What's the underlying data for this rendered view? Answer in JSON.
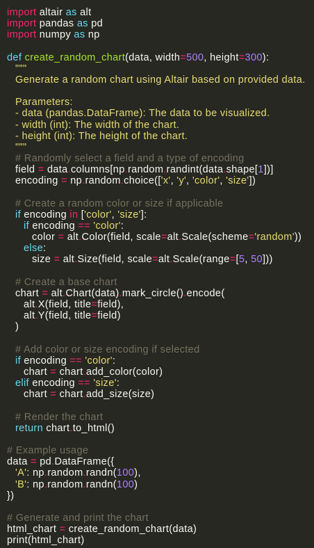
{
  "theme": {
    "background": "#272822",
    "colors": {
      "d": "#f8f8f2",
      "k": "#f92672",
      "o": "#f92672",
      "b": "#66d9ef",
      "f": "#a6e22e",
      "n": "#ae81ff",
      "s": "#e6db74",
      "c": "#75715e"
    }
  },
  "editor": {
    "language": "python",
    "lines": [
      {
        "i": 0,
        "t": [
          [
            "k",
            "import"
          ],
          [
            "d",
            " altair "
          ],
          [
            "b",
            "as"
          ],
          [
            "d",
            " alt"
          ]
        ]
      },
      {
        "i": 0,
        "t": [
          [
            "k",
            "import"
          ],
          [
            "d",
            " pandas "
          ],
          [
            "b",
            "as"
          ],
          [
            "d",
            " pd"
          ]
        ]
      },
      {
        "i": 0,
        "t": [
          [
            "k",
            "import"
          ],
          [
            "d",
            " numpy "
          ],
          [
            "b",
            "as"
          ],
          [
            "d",
            " np"
          ]
        ]
      },
      {
        "i": 0,
        "t": []
      },
      {
        "i": 0,
        "t": [
          [
            "b",
            "def"
          ],
          [
            "d",
            " "
          ],
          [
            "f",
            "create_random_chart"
          ],
          [
            "d",
            "(data, width"
          ],
          [
            "o",
            "="
          ],
          [
            "n",
            "500"
          ],
          [
            "d",
            ", height"
          ],
          [
            "o",
            "="
          ],
          [
            "n",
            "300"
          ],
          [
            "d",
            "):"
          ]
        ]
      },
      {
        "i": 1,
        "t": [
          [
            "s",
            "\"\"\""
          ]
        ]
      },
      {
        "i": 1,
        "t": [
          [
            "s",
            "Generate a random chart using Altair based on provided data."
          ]
        ]
      },
      {
        "i": 0,
        "t": []
      },
      {
        "i": 1,
        "t": [
          [
            "s",
            "Parameters:"
          ]
        ]
      },
      {
        "i": 1,
        "t": [
          [
            "s",
            "- data (pandas.DataFrame): The data to be visualized."
          ]
        ]
      },
      {
        "i": 1,
        "t": [
          [
            "s",
            "- width (int): The width of the chart."
          ]
        ]
      },
      {
        "i": 1,
        "t": [
          [
            "s",
            "- height (int): The height of the chart."
          ]
        ]
      },
      {
        "i": 1,
        "t": [
          [
            "s",
            "\"\"\""
          ]
        ]
      },
      {
        "i": 1,
        "t": [
          [
            "c",
            "# Randomly select a field and a type of encoding"
          ]
        ]
      },
      {
        "i": 1,
        "t": [
          [
            "d",
            "field "
          ],
          [
            "o",
            "="
          ],
          [
            "d",
            " data"
          ],
          [
            "o",
            "."
          ],
          [
            "d",
            "columns[np"
          ],
          [
            "o",
            "."
          ],
          [
            "d",
            "random"
          ],
          [
            "o",
            "."
          ],
          [
            "d",
            "randint(data"
          ],
          [
            "o",
            "."
          ],
          [
            "d",
            "shape["
          ],
          [
            "n",
            "1"
          ],
          [
            "d",
            "])]"
          ]
        ]
      },
      {
        "i": 1,
        "t": [
          [
            "d",
            "encoding "
          ],
          [
            "o",
            "="
          ],
          [
            "d",
            " np"
          ],
          [
            "o",
            "."
          ],
          [
            "d",
            "random"
          ],
          [
            "o",
            "."
          ],
          [
            "d",
            "choice(["
          ],
          [
            "s",
            "'x'"
          ],
          [
            "d",
            ", "
          ],
          [
            "s",
            "'y'"
          ],
          [
            "d",
            ", "
          ],
          [
            "s",
            "'color'"
          ],
          [
            "d",
            ", "
          ],
          [
            "s",
            "'size'"
          ],
          [
            "d",
            "])"
          ]
        ]
      },
      {
        "i": 0,
        "t": []
      },
      {
        "i": 1,
        "t": [
          [
            "c",
            "# Create a random color or size if applicable"
          ]
        ]
      },
      {
        "i": 1,
        "t": [
          [
            "b",
            "if"
          ],
          [
            "d",
            " encoding "
          ],
          [
            "k",
            "in"
          ],
          [
            "d",
            " ["
          ],
          [
            "s",
            "'color'"
          ],
          [
            "d",
            ", "
          ],
          [
            "s",
            "'size'"
          ],
          [
            "d",
            "]:"
          ]
        ]
      },
      {
        "i": 2,
        "t": [
          [
            "b",
            "if"
          ],
          [
            "d",
            " encoding "
          ],
          [
            "o",
            "=="
          ],
          [
            "d",
            " "
          ],
          [
            "s",
            "'color'"
          ],
          [
            "d",
            ":"
          ]
        ]
      },
      {
        "i": 3,
        "t": [
          [
            "d",
            "color "
          ],
          [
            "o",
            "="
          ],
          [
            "d",
            " alt"
          ],
          [
            "o",
            "."
          ],
          [
            "d",
            "Color(field, scale"
          ],
          [
            "o",
            "="
          ],
          [
            "d",
            "alt"
          ],
          [
            "o",
            "."
          ],
          [
            "d",
            "Scale(scheme"
          ],
          [
            "o",
            "="
          ],
          [
            "s",
            "'random'"
          ],
          [
            "d",
            "))"
          ]
        ]
      },
      {
        "i": 2,
        "t": [
          [
            "b",
            "else"
          ],
          [
            "d",
            ":"
          ]
        ]
      },
      {
        "i": 3,
        "t": [
          [
            "d",
            "size "
          ],
          [
            "o",
            "="
          ],
          [
            "d",
            " alt"
          ],
          [
            "o",
            "."
          ],
          [
            "d",
            "Size(field, scale"
          ],
          [
            "o",
            "="
          ],
          [
            "d",
            "alt"
          ],
          [
            "o",
            "."
          ],
          [
            "d",
            "Scale(range"
          ],
          [
            "o",
            "="
          ],
          [
            "d",
            "["
          ],
          [
            "n",
            "5"
          ],
          [
            "d",
            ", "
          ],
          [
            "n",
            "50"
          ],
          [
            "d",
            "]))"
          ]
        ]
      },
      {
        "i": 0,
        "t": []
      },
      {
        "i": 1,
        "t": [
          [
            "c",
            "# Create a base chart"
          ]
        ]
      },
      {
        "i": 1,
        "t": [
          [
            "d",
            "chart "
          ],
          [
            "o",
            "="
          ],
          [
            "d",
            " alt"
          ],
          [
            "o",
            "."
          ],
          [
            "d",
            "Chart(data)"
          ],
          [
            "o",
            "."
          ],
          [
            "d",
            "mark_circle()"
          ],
          [
            "o",
            "."
          ],
          [
            "d",
            "encode("
          ]
        ]
      },
      {
        "i": 2,
        "t": [
          [
            "d",
            "alt"
          ],
          [
            "o",
            "."
          ],
          [
            "d",
            "X(field, title"
          ],
          [
            "o",
            "="
          ],
          [
            "d",
            "field),"
          ]
        ]
      },
      {
        "i": 2,
        "t": [
          [
            "d",
            "alt"
          ],
          [
            "o",
            "."
          ],
          [
            "d",
            "Y(field, title"
          ],
          [
            "o",
            "="
          ],
          [
            "d",
            "field)"
          ]
        ]
      },
      {
        "i": 1,
        "t": [
          [
            "d",
            ")"
          ]
        ]
      },
      {
        "i": 0,
        "t": []
      },
      {
        "i": 1,
        "t": [
          [
            "c",
            "# Add color or size encoding if selected"
          ]
        ]
      },
      {
        "i": 1,
        "t": [
          [
            "b",
            "if"
          ],
          [
            "d",
            " encoding "
          ],
          [
            "o",
            "=="
          ],
          [
            "d",
            " "
          ],
          [
            "s",
            "'color'"
          ],
          [
            "d",
            ":"
          ]
        ]
      },
      {
        "i": 2,
        "t": [
          [
            "d",
            "chart "
          ],
          [
            "o",
            "="
          ],
          [
            "d",
            " chart"
          ],
          [
            "o",
            "."
          ],
          [
            "d",
            "add_color(color)"
          ]
        ]
      },
      {
        "i": 1,
        "t": [
          [
            "b",
            "elif"
          ],
          [
            "d",
            " encoding "
          ],
          [
            "o",
            "=="
          ],
          [
            "d",
            " "
          ],
          [
            "s",
            "'size'"
          ],
          [
            "d",
            ":"
          ]
        ]
      },
      {
        "i": 2,
        "t": [
          [
            "d",
            "chart "
          ],
          [
            "o",
            "="
          ],
          [
            "d",
            " chart"
          ],
          [
            "o",
            "."
          ],
          [
            "d",
            "add_size(size)"
          ]
        ]
      },
      {
        "i": 0,
        "t": []
      },
      {
        "i": 1,
        "t": [
          [
            "c",
            "# Render the chart"
          ]
        ]
      },
      {
        "i": 1,
        "t": [
          [
            "b",
            "return"
          ],
          [
            "d",
            " chart"
          ],
          [
            "o",
            "."
          ],
          [
            "d",
            "to_html()"
          ]
        ]
      },
      {
        "i": 0,
        "t": []
      },
      {
        "i": 0,
        "t": [
          [
            "c",
            "# Example usage"
          ]
        ]
      },
      {
        "i": 0,
        "t": [
          [
            "d",
            "data "
          ],
          [
            "o",
            "="
          ],
          [
            "d",
            " pd"
          ],
          [
            "o",
            "."
          ],
          [
            "d",
            "DataFrame({"
          ]
        ]
      },
      {
        "i": 1,
        "t": [
          [
            "s",
            "'A'"
          ],
          [
            "d",
            ": np"
          ],
          [
            "o",
            "."
          ],
          [
            "d",
            "random"
          ],
          [
            "o",
            "."
          ],
          [
            "d",
            "randn("
          ],
          [
            "n",
            "100"
          ],
          [
            "d",
            "),"
          ]
        ]
      },
      {
        "i": 1,
        "t": [
          [
            "s",
            "'B'"
          ],
          [
            "d",
            ": np"
          ],
          [
            "o",
            "."
          ],
          [
            "d",
            "random"
          ],
          [
            "o",
            "."
          ],
          [
            "d",
            "randn("
          ],
          [
            "n",
            "100"
          ],
          [
            "d",
            ")"
          ]
        ]
      },
      {
        "i": 0,
        "t": [
          [
            "d",
            "})"
          ]
        ]
      },
      {
        "i": 0,
        "t": []
      },
      {
        "i": 0,
        "t": [
          [
            "c",
            "# Generate and print the chart"
          ]
        ]
      },
      {
        "i": 0,
        "t": [
          [
            "d",
            "html_chart "
          ],
          [
            "o",
            "="
          ],
          [
            "d",
            " create_random_chart(data)"
          ]
        ]
      },
      {
        "i": 0,
        "t": [
          [
            "d",
            "print(html_chart)"
          ]
        ]
      }
    ]
  }
}
